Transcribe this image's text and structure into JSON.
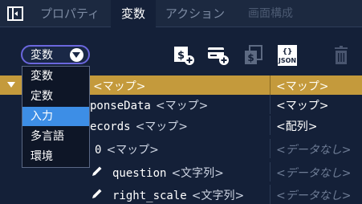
{
  "tabs": [
    {
      "label": "プロパティ"
    },
    {
      "label": "変数"
    },
    {
      "label": "アクション"
    },
    {
      "label": "画面構成"
    }
  ],
  "active_tab": "変数",
  "scope_select": {
    "value": "変数",
    "options": [
      "変数",
      "定数",
      "入力",
      "多言語",
      "環境"
    ],
    "highlighted": "入力"
  },
  "toolbar": {
    "icons": [
      "add-dollar-icon",
      "add-card-icon",
      "copy-dollar-icon",
      "json-icon",
      "trash-icon"
    ],
    "json_label": "{}\nJSON",
    "json_text": "JSON",
    "json_braces": "{}"
  },
  "tree": [
    {
      "key": "",
      "type": "<マップ>",
      "value": "<マップ>"
    },
    {
      "key": "ponseData",
      "type": "<マップ>",
      "value": "<マップ>"
    },
    {
      "key": "ecords",
      "type": "<マップ>",
      "value": "<配列>"
    },
    {
      "key": "0",
      "type": "<マップ>",
      "value": "<データなし>"
    },
    {
      "key": "question",
      "type": "<文字列>",
      "value": "<データなし>"
    },
    {
      "key": "right_scale",
      "type": "<文字列>",
      "value": "<データなし>"
    }
  ],
  "colors": {
    "background": "#142038",
    "selected_row": "#c49a3c",
    "dropdown_highlight": "#3d8ee6",
    "select_border": "#6b67de"
  }
}
